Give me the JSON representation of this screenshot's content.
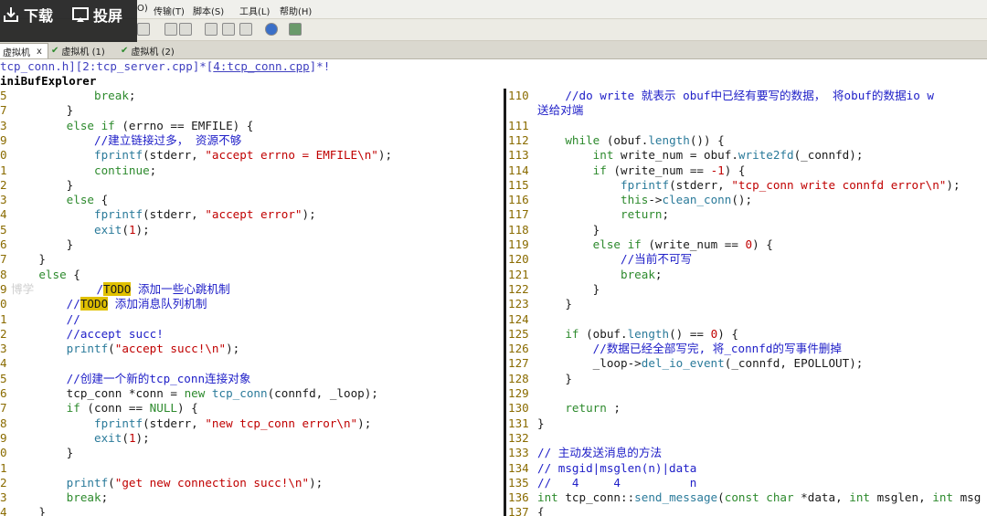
{
  "overlay": {
    "download_label": "下载",
    "cast_label": "投屏"
  },
  "menubar": {
    "items": [
      "O)",
      "传输(T)",
      "脚本(S)",
      "工具(L)",
      "帮助(H)"
    ]
  },
  "tabs": [
    {
      "label": "虚拟机",
      "close": "x",
      "active": true
    },
    {
      "label": "虚拟机 (1)",
      "active": false
    },
    {
      "label": "虚拟机 (2)",
      "active": false
    }
  ],
  "buffer_bar": {
    "text_a": "tcp_conn.h][2:tcp_server.cpp]*[",
    "text_b": "4:tcp_conn.cpp",
    "text_c": "]*!"
  },
  "buffer_explorer_label": "iniBufExplorer",
  "left_lines": [
    [
      [
        "ln",
        "5"
      ],
      [
        "",
        "            "
      ],
      [
        "kw",
        "break"
      ],
      [
        "",
        ";"
      ]
    ],
    [
      [
        "ln",
        "7"
      ],
      [
        "",
        "        }"
      ]
    ],
    [
      [
        "ln",
        "3"
      ],
      [
        "",
        "        "
      ],
      [
        "kw",
        "else if"
      ],
      [
        "",
        " (errno == EMFILE) {"
      ]
    ],
    [
      [
        "ln",
        "9"
      ],
      [
        "",
        "            "
      ],
      [
        "cm",
        "//建立链接过多， 资源不够"
      ]
    ],
    [
      [
        "ln",
        "0"
      ],
      [
        "",
        "            "
      ],
      [
        "fn",
        "fprintf"
      ],
      [
        "",
        "(stderr, "
      ],
      [
        "st",
        "\"accept errno = EMFILE\\n\""
      ],
      [
        "",
        ");"
      ]
    ],
    [
      [
        "ln",
        "1"
      ],
      [
        "",
        "            "
      ],
      [
        "kw",
        "continue"
      ],
      [
        "",
        ";"
      ]
    ],
    [
      [
        "ln",
        "2"
      ],
      [
        "",
        "        }"
      ]
    ],
    [
      [
        "ln",
        "3"
      ],
      [
        "",
        "        "
      ],
      [
        "kw",
        "else"
      ],
      [
        "",
        " {"
      ]
    ],
    [
      [
        "ln",
        "4"
      ],
      [
        "",
        "            "
      ],
      [
        "fn",
        "fprintf"
      ],
      [
        "",
        "(stderr, "
      ],
      [
        "st",
        "\"accept error\""
      ],
      [
        "",
        ");"
      ]
    ],
    [
      [
        "ln",
        "5"
      ],
      [
        "",
        "            "
      ],
      [
        "fn",
        "exit"
      ],
      [
        "",
        "("
      ],
      [
        "nm",
        "1"
      ],
      [
        "",
        ");"
      ]
    ],
    [
      [
        "ln",
        "6"
      ],
      [
        "",
        "        }"
      ]
    ],
    [
      [
        "ln",
        "7"
      ],
      [
        "",
        "    }"
      ]
    ],
    [
      [
        "ln",
        "8"
      ],
      [
        "",
        "    "
      ],
      [
        "kw",
        "else"
      ],
      [
        "",
        " {"
      ]
    ],
    [
      [
        "ln",
        "9"
      ],
      [
        "wm",
        "博学"
      ],
      [
        "",
        "         "
      ],
      [
        "cm",
        "/"
      ],
      [
        "hl",
        "TODO"
      ],
      [
        "cm",
        " 添加一些心跳机制"
      ]
    ],
    [
      [
        "ln",
        "0"
      ],
      [
        "",
        "        "
      ],
      [
        "cm",
        "//"
      ],
      [
        "hl",
        "TODO"
      ],
      [
        "cm",
        " 添加消息队列机制"
      ]
    ],
    [
      [
        "ln",
        "1"
      ],
      [
        "",
        "        "
      ],
      [
        "cm",
        "//"
      ]
    ],
    [
      [
        "ln",
        "2"
      ],
      [
        "",
        "        "
      ],
      [
        "cm",
        "//accept succ!"
      ]
    ],
    [
      [
        "ln",
        "3"
      ],
      [
        "",
        "        "
      ],
      [
        "fn",
        "printf"
      ],
      [
        "",
        "("
      ],
      [
        "st",
        "\"accept succ!\\n\""
      ],
      [
        "",
        ");"
      ]
    ],
    [
      [
        "ln",
        "4"
      ],
      [
        "",
        ""
      ]
    ],
    [
      [
        "ln",
        "5"
      ],
      [
        "",
        "        "
      ],
      [
        "cm",
        "//创建一个新的tcp_conn连接对象"
      ]
    ],
    [
      [
        "ln",
        "6"
      ],
      [
        "",
        "        tcp_conn *conn = "
      ],
      [
        "kw",
        "new"
      ],
      [
        "",
        " "
      ],
      [
        "fn",
        "tcp_conn"
      ],
      [
        "",
        "(connfd, _loop);"
      ]
    ],
    [
      [
        "ln",
        "7"
      ],
      [
        "",
        "        "
      ],
      [
        "kw",
        "if"
      ],
      [
        "",
        " (conn == "
      ],
      [
        "ty",
        "NULL"
      ],
      [
        "",
        ") {"
      ]
    ],
    [
      [
        "ln",
        "8"
      ],
      [
        "",
        "            "
      ],
      [
        "fn",
        "fprintf"
      ],
      [
        "",
        "(stderr, "
      ],
      [
        "st",
        "\"new tcp_conn error\\n\""
      ],
      [
        "",
        ");"
      ]
    ],
    [
      [
        "ln",
        "9"
      ],
      [
        "",
        "            "
      ],
      [
        "fn",
        "exit"
      ],
      [
        "",
        "("
      ],
      [
        "nm",
        "1"
      ],
      [
        "",
        ");"
      ]
    ],
    [
      [
        "ln",
        "0"
      ],
      [
        "",
        "        }"
      ]
    ],
    [
      [
        "ln",
        "1"
      ],
      [
        "",
        ""
      ]
    ],
    [
      [
        "ln",
        "2"
      ],
      [
        "",
        "        "
      ],
      [
        "fn",
        "printf"
      ],
      [
        "",
        "("
      ],
      [
        "st",
        "\"get new connection succ!\\n\""
      ],
      [
        "",
        ");"
      ]
    ],
    [
      [
        "ln",
        "3"
      ],
      [
        "",
        "        "
      ],
      [
        "kw",
        "break"
      ],
      [
        "",
        ";"
      ]
    ],
    [
      [
        "ln",
        "4"
      ],
      [
        "",
        "    }"
      ]
    ]
  ],
  "right_lines": [
    [
      [
        "ln",
        "110"
      ],
      [
        "",
        "    "
      ],
      [
        "cm",
        "//do write 就表示 obuf中已经有要写的数据， 将obuf的数据io w"
      ]
    ],
    [
      [
        "ln",
        ""
      ],
      [
        "cm",
        "送给对端"
      ]
    ],
    [
      [
        "ln",
        "111"
      ],
      [
        "",
        ""
      ]
    ],
    [
      [
        "ln",
        "112"
      ],
      [
        "",
        "    "
      ],
      [
        "kw",
        "while"
      ],
      [
        "",
        " (obuf."
      ],
      [
        "fn",
        "length"
      ],
      [
        "",
        "()) {"
      ]
    ],
    [
      [
        "ln",
        "113"
      ],
      [
        "",
        "        "
      ],
      [
        "ty",
        "int"
      ],
      [
        "",
        " write_num = obuf."
      ],
      [
        "fn",
        "write2fd"
      ],
      [
        "",
        "(_connfd);"
      ]
    ],
    [
      [
        "ln",
        "114"
      ],
      [
        "",
        "        "
      ],
      [
        "kw",
        "if"
      ],
      [
        "",
        " (write_num == "
      ],
      [
        "nm",
        "-1"
      ],
      [
        "",
        ") {"
      ]
    ],
    [
      [
        "ln",
        "115"
      ],
      [
        "",
        "            "
      ],
      [
        "fn",
        "fprintf"
      ],
      [
        "",
        "(stderr, "
      ],
      [
        "st",
        "\"tcp_conn write connfd error\\n\""
      ],
      [
        "",
        ");"
      ]
    ],
    [
      [
        "ln",
        "116"
      ],
      [
        "",
        "            "
      ],
      [
        "kw",
        "this"
      ],
      [
        "",
        "->"
      ],
      [
        "fn",
        "clean_conn"
      ],
      [
        "",
        "();"
      ]
    ],
    [
      [
        "ln",
        "117"
      ],
      [
        "",
        "            "
      ],
      [
        "kw",
        "return"
      ],
      [
        "",
        ";"
      ]
    ],
    [
      [
        "ln",
        "118"
      ],
      [
        "",
        "        }"
      ]
    ],
    [
      [
        "ln",
        "119"
      ],
      [
        "",
        "        "
      ],
      [
        "kw",
        "else if"
      ],
      [
        "",
        " (write_num == "
      ],
      [
        "nm",
        "0"
      ],
      [
        "",
        ") {"
      ]
    ],
    [
      [
        "ln",
        "120"
      ],
      [
        "",
        "            "
      ],
      [
        "cm",
        "//当前不可写"
      ]
    ],
    [
      [
        "ln",
        "121"
      ],
      [
        "",
        "            "
      ],
      [
        "kw",
        "break"
      ],
      [
        "",
        ";"
      ]
    ],
    [
      [
        "ln",
        "122"
      ],
      [
        "",
        "        }"
      ]
    ],
    [
      [
        "ln",
        "123"
      ],
      [
        "",
        "    }"
      ]
    ],
    [
      [
        "ln",
        "124"
      ],
      [
        "",
        ""
      ]
    ],
    [
      [
        "ln",
        "125"
      ],
      [
        "",
        "    "
      ],
      [
        "kw",
        "if"
      ],
      [
        "",
        " (obuf."
      ],
      [
        "fn",
        "length"
      ],
      [
        "",
        "() == "
      ],
      [
        "nm",
        "0"
      ],
      [
        "",
        ") {"
      ]
    ],
    [
      [
        "ln",
        "126"
      ],
      [
        "",
        "        "
      ],
      [
        "cm",
        "//数据已经全部写完, 将_connfd的写事件删掉"
      ]
    ],
    [
      [
        "ln",
        "127"
      ],
      [
        "",
        "        _loop->"
      ],
      [
        "fn",
        "del_io_event"
      ],
      [
        "",
        "(_connfd, EPOLLOUT);"
      ]
    ],
    [
      [
        "ln",
        "128"
      ],
      [
        "",
        "    }"
      ]
    ],
    [
      [
        "ln",
        "129"
      ],
      [
        "",
        ""
      ]
    ],
    [
      [
        "ln",
        "130"
      ],
      [
        "",
        "    "
      ],
      [
        "kw",
        "return"
      ],
      [
        "",
        " ;"
      ]
    ],
    [
      [
        "ln",
        "131"
      ],
      [
        "",
        "}"
      ]
    ],
    [
      [
        "ln",
        "132"
      ],
      [
        "",
        ""
      ]
    ],
    [
      [
        "ln",
        "133"
      ],
      [
        "cm",
        "// 主动发送消息的方法"
      ]
    ],
    [
      [
        "ln",
        "134"
      ],
      [
        "cm",
        "// msgid|msglen(n)|data"
      ]
    ],
    [
      [
        "ln",
        "135"
      ],
      [
        "cm",
        "//   4     4          n"
      ]
    ],
    [
      [
        "ln",
        "136"
      ],
      [
        "ty",
        "int"
      ],
      [
        "",
        " tcp_conn::"
      ],
      [
        "fn",
        "send_message"
      ],
      [
        "",
        "("
      ],
      [
        "ty",
        "const char"
      ],
      [
        "",
        " *data, "
      ],
      [
        "ty",
        "int"
      ],
      [
        "",
        " msglen, "
      ],
      [
        "ty",
        "int"
      ],
      [
        "",
        " msg"
      ]
    ],
    [
      [
        "ln",
        "137"
      ],
      [
        "",
        "{"
      ]
    ]
  ],
  "colors": {
    "keyword": "#2d8a2d",
    "comment": "#2020c8",
    "string": "#c00000",
    "todo_highlight": "#e0c000",
    "line_number": "#8a6b00"
  },
  "icons": [
    "download-icon",
    "cast-icon",
    "check-icon",
    "close-icon"
  ]
}
